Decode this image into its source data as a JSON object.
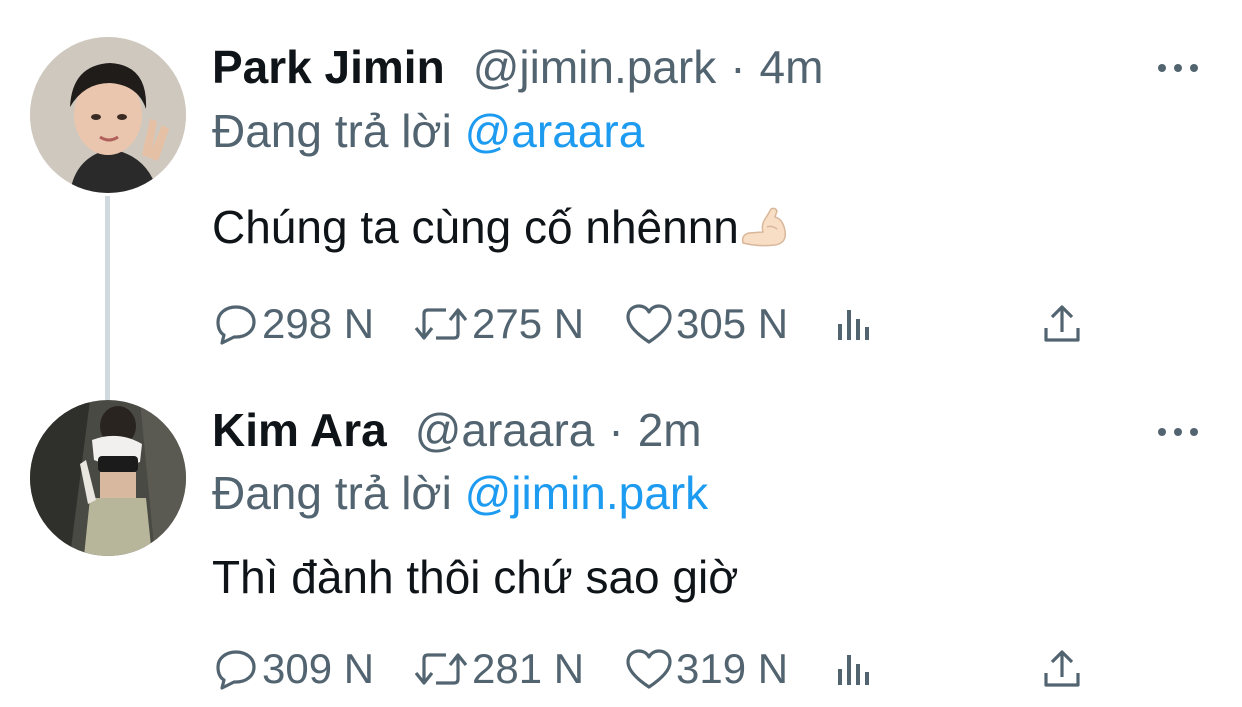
{
  "tweets": [
    {
      "name": "Park Jimin",
      "handle": "@jimin.park",
      "separator": "·",
      "time": "4m",
      "reply_prefix": "Đang trả lời",
      "reply_to": "@araara",
      "text": "Chúng ta cùng cố nhênnn",
      "emoji": "flexed-biceps",
      "avatar_icon": "avatar-park-jimin",
      "actions": {
        "replies": "298 N",
        "retweets": "275 N",
        "likes": "305 N"
      }
    },
    {
      "name": "Kim Ara",
      "handle": "@araara",
      "separator": "·",
      "time": "2m",
      "reply_prefix": "Đang trả lời",
      "reply_to": "@jimin.park",
      "text": "Thì đành thôi chứ sao giờ",
      "avatar_icon": "avatar-kim-ara",
      "actions": {
        "replies": "309 N",
        "retweets": "281 N",
        "likes": "319 N"
      }
    }
  ],
  "colors": {
    "text": "#0f1419",
    "secondary": "#536471",
    "link": "#1d9bf0",
    "thread_line": "#cfd9de"
  },
  "icons": [
    "reply-icon",
    "retweet-icon",
    "like-icon",
    "views-icon",
    "share-icon",
    "more-icon"
  ]
}
